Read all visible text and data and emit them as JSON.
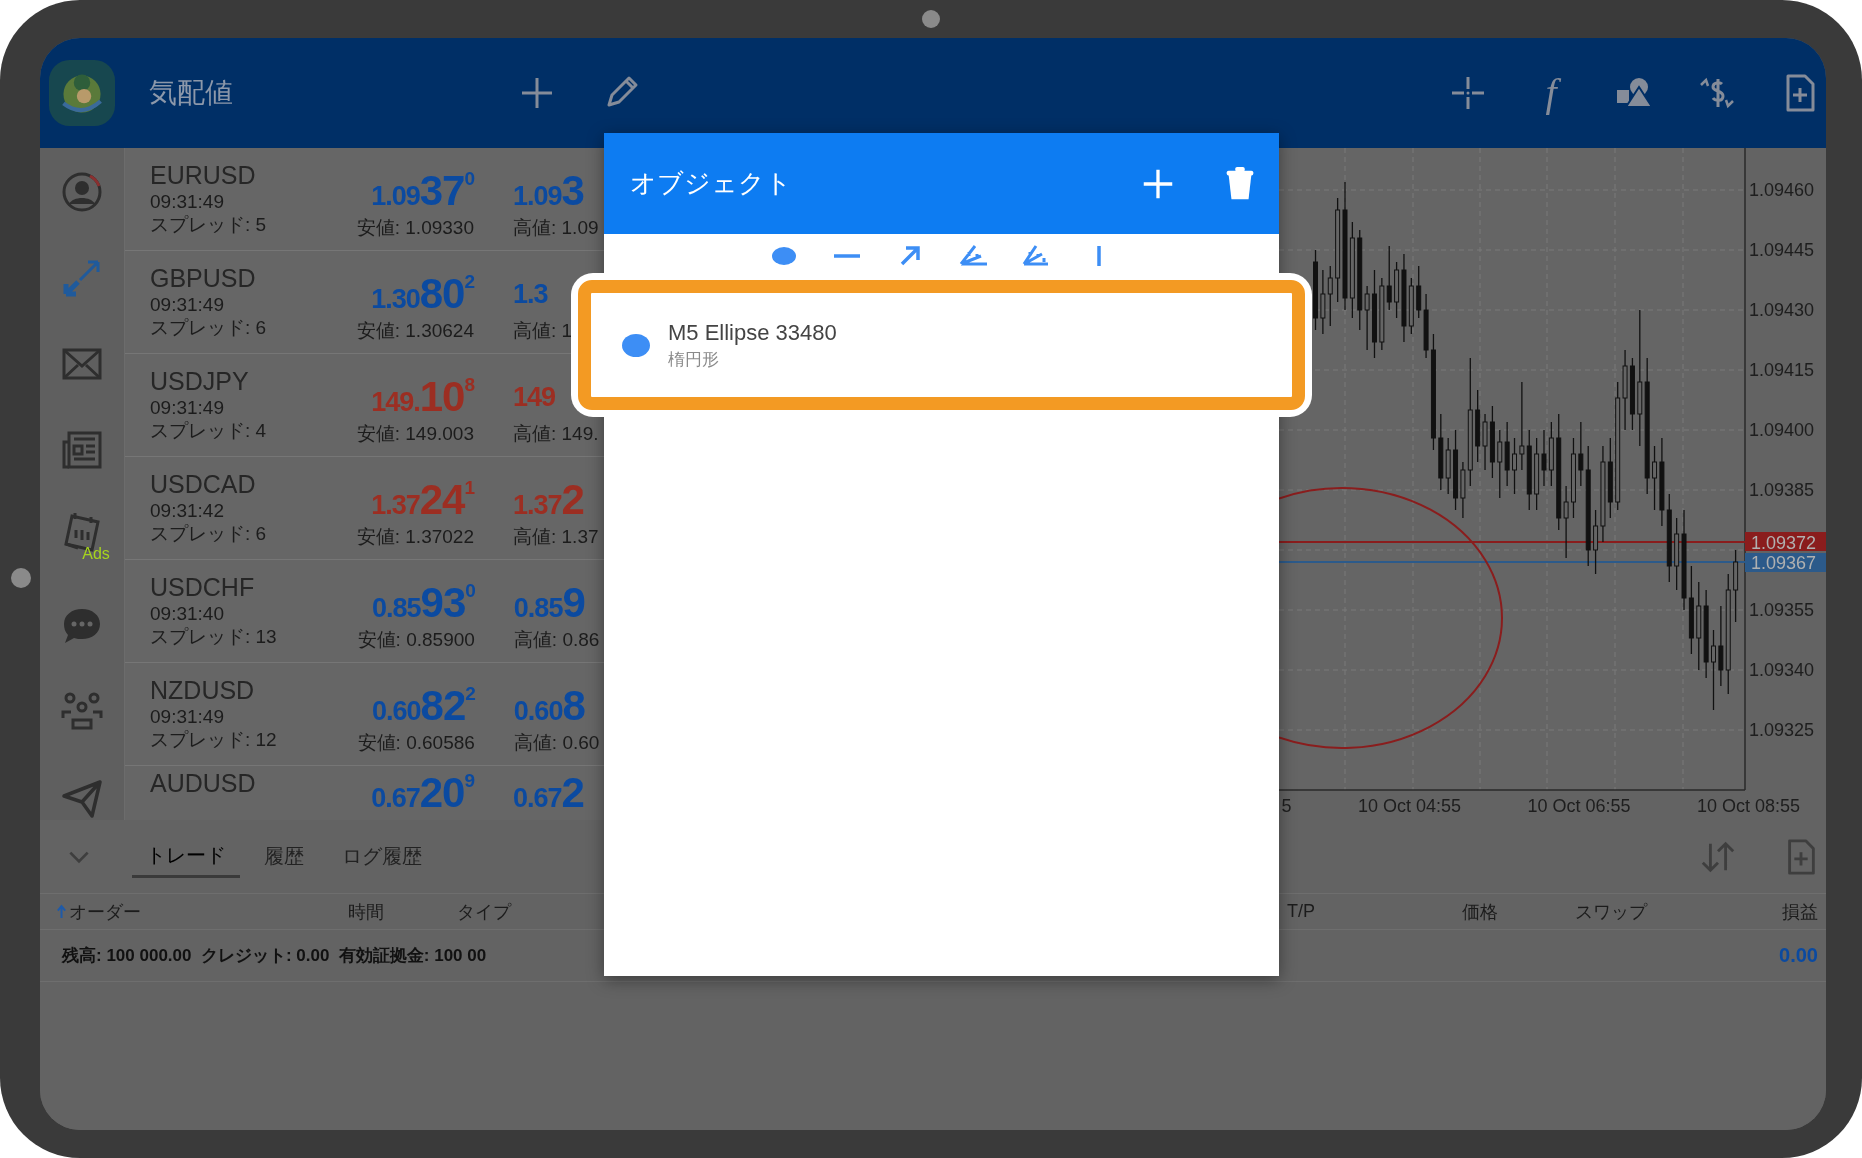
{
  "top_bar": {
    "title": "気配値",
    "function_glyph": "f"
  },
  "rail": {
    "ads_label": "Ads"
  },
  "quotes": [
    {
      "symbol": "EURUSD",
      "time": "09:31:49",
      "spread": "スプレッド: 5",
      "color": "#0b4aa0",
      "bid": {
        "prefix": "1.09",
        "big": "37",
        "sup": "0"
      },
      "low": "安値: 1.09330",
      "ask": {
        "prefix": "1.09",
        "big": "3"
      },
      "high": "高値: 1.09"
    },
    {
      "symbol": "GBPUSD",
      "time": "09:31:49",
      "spread": "スプレッド: 6",
      "color": "#0b4aa0",
      "bid": {
        "prefix": "1.30",
        "big": "80",
        "sup": "2"
      },
      "low": "安値: 1.30624",
      "ask": {
        "prefix": "1.3"
      },
      "high": "高値: 1"
    },
    {
      "symbol": "USDJPY",
      "time": "09:31:49",
      "spread": "スプレッド: 4",
      "color": "#9c2e22",
      "bid": {
        "prefix": "149.",
        "big": "10",
        "sup": "8"
      },
      "low": "安値: 149.003",
      "ask": {
        "prefix": "149"
      },
      "high": "高値: 149."
    },
    {
      "symbol": "USDCAD",
      "time": "09:31:42",
      "spread": "スプレッド: 6",
      "color": "#9c2e22",
      "bid": {
        "prefix": "1.37",
        "big": "24",
        "sup": "1"
      },
      "low": "安値: 1.37022",
      "ask": {
        "prefix": "1.37",
        "big": "2"
      },
      "high": "高値: 1.37"
    },
    {
      "symbol": "USDCHF",
      "time": "09:31:40",
      "spread": "スプレッド: 13",
      "color": "#0b4aa0",
      "bid": {
        "prefix": "0.85",
        "big": "93",
        "sup": "0"
      },
      "low": "安値: 0.85900",
      "ask": {
        "prefix": "0.85",
        "big": "9"
      },
      "high": "高値: 0.86"
    },
    {
      "symbol": "NZDUSD",
      "time": "09:31:49",
      "spread": "スプレッド: 12",
      "color": "#0b4aa0",
      "bid": {
        "prefix": "0.60",
        "big": "82",
        "sup": "2"
      },
      "low": "安値: 0.60586",
      "ask": {
        "prefix": "0.60",
        "big": "8"
      },
      "high": "高値: 0.60"
    },
    {
      "symbol": "AUDUSD",
      "color": "#0b4aa0",
      "bid": {
        "prefix": "0.67",
        "big": "20",
        "sup": "9"
      },
      "ask": {
        "prefix": "0.67",
        "big": "2"
      }
    }
  ],
  "chart": {
    "time_labels": [
      "5",
      "10 Oct 04:55",
      "10 Oct 06:55",
      "10 Oct 08:55"
    ],
    "chart_data": {
      "type": "candlestick",
      "grid": true,
      "ylim": [
        1.0931,
        1.094705
      ],
      "ohlc": [
        [
          1.09442,
          1.09445,
          1.09425,
          1.09428
        ],
        [
          1.09428,
          1.0944,
          1.09424,
          1.09434
        ],
        [
          1.09434,
          1.09441,
          1.09426,
          1.09438
        ],
        [
          1.09438,
          1.09458,
          1.09432,
          1.09455
        ],
        [
          1.09455,
          1.09462,
          1.0943,
          1.09433
        ],
        [
          1.09433,
          1.09452,
          1.09428,
          1.09448
        ],
        [
          1.09448,
          1.0945,
          1.09425,
          1.0943
        ],
        [
          1.0943,
          1.09436,
          1.0942,
          1.09434
        ],
        [
          1.09434,
          1.0944,
          1.09418,
          1.09422
        ],
        [
          1.09422,
          1.09438,
          1.0942,
          1.09436
        ],
        [
          1.09436,
          1.09446,
          1.0943,
          1.09432
        ],
        [
          1.09432,
          1.09442,
          1.09428,
          1.0944
        ],
        [
          1.0944,
          1.09444,
          1.09422,
          1.09426
        ],
        [
          1.09426,
          1.09438,
          1.09424,
          1.09436
        ],
        [
          1.09436,
          1.09441,
          1.09428,
          1.0943
        ],
        [
          1.0943,
          1.09434,
          1.09418,
          1.0942
        ],
        [
          1.0942,
          1.09424,
          1.09395,
          1.09398
        ],
        [
          1.09398,
          1.09404,
          1.09385,
          1.09388
        ],
        [
          1.09388,
          1.09398,
          1.09384,
          1.09395
        ],
        [
          1.09395,
          1.094,
          1.0938,
          1.09383
        ],
        [
          1.09383,
          1.09392,
          1.09378,
          1.0939
        ],
        [
          1.0939,
          1.09418,
          1.09386,
          1.09405
        ],
        [
          1.09405,
          1.0941,
          1.09392,
          1.09396
        ],
        [
          1.09396,
          1.09404,
          1.0939,
          1.09402
        ],
        [
          1.09402,
          1.09406,
          1.09388,
          1.09392
        ],
        [
          1.09392,
          1.094,
          1.09383,
          1.09397
        ],
        [
          1.09397,
          1.09402,
          1.09386,
          1.0939
        ],
        [
          1.0939,
          1.09398,
          1.09384,
          1.09394
        ],
        [
          1.09394,
          1.09412,
          1.0939,
          1.09396
        ],
        [
          1.09396,
          1.094,
          1.0938,
          1.09384
        ],
        [
          1.09384,
          1.09398,
          1.0938,
          1.09394
        ],
        [
          1.09394,
          1.094,
          1.09386,
          1.0939
        ],
        [
          1.0939,
          1.09402,
          1.09386,
          1.09398
        ],
        [
          1.09398,
          1.09404,
          1.09375,
          1.09378
        ],
        [
          1.09378,
          1.09386,
          1.09368,
          1.09382
        ],
        [
          1.09382,
          1.09398,
          1.09378,
          1.09394
        ],
        [
          1.09394,
          1.09402,
          1.09386,
          1.0939
        ],
        [
          1.0939,
          1.09396,
          1.09366,
          1.0937
        ],
        [
          1.0937,
          1.0938,
          1.09364,
          1.09376
        ],
        [
          1.09376,
          1.09396,
          1.09372,
          1.09392
        ],
        [
          1.09392,
          1.09398,
          1.09378,
          1.09382
        ],
        [
          1.09382,
          1.09412,
          1.0938,
          1.09408
        ],
        [
          1.09408,
          1.0942,
          1.094,
          1.09416
        ],
        [
          1.09416,
          1.09418,
          1.094,
          1.09404
        ],
        [
          1.09404,
          1.0943,
          1.09396,
          1.09412
        ],
        [
          1.09412,
          1.09418,
          1.09384,
          1.09388
        ],
        [
          1.09388,
          1.09396,
          1.0938,
          1.09392
        ],
        [
          1.09392,
          1.09398,
          1.09376,
          1.0938
        ],
        [
          1.0938,
          1.09384,
          1.09362,
          1.09366
        ],
        [
          1.09366,
          1.09378,
          1.0936,
          1.09374
        ],
        [
          1.09374,
          1.0938,
          1.09355,
          1.09358
        ],
        [
          1.09358,
          1.09366,
          1.09344,
          1.09348
        ],
        [
          1.09348,
          1.09362,
          1.0934,
          1.09356
        ],
        [
          1.09356,
          1.0936,
          1.09338,
          1.09342
        ],
        [
          1.09342,
          1.0935,
          1.0933,
          1.09346
        ],
        [
          1.09346,
          1.09356,
          1.09336,
          1.0934
        ],
        [
          1.0934,
          1.09364,
          1.09334,
          1.0936
        ],
        [
          1.0936,
          1.0937,
          1.09352,
          1.09367
        ]
      ],
      "yticks": [
        {
          "value": 1.0946,
          "label": "1.09460"
        },
        {
          "value": 1.09445,
          "label": "1.09445"
        },
        {
          "value": 1.0943,
          "label": "1.09430"
        },
        {
          "value": 1.09415,
          "label": "1.09415"
        },
        {
          "value": 1.094,
          "label": "1.09400"
        },
        {
          "value": 1.09385,
          "label": "1.09385"
        },
        {
          "value": 1.09355,
          "label": "1.09355"
        },
        {
          "value": 1.0934,
          "label": "1.09340"
        },
        {
          "value": 1.09325,
          "label": "1.09325"
        }
      ],
      "ref_lines": [
        {
          "axis": "y",
          "value": 1.09372,
          "label": "1.09372",
          "color": "#8a1d1d"
        },
        {
          "axis": "y",
          "value": 1.09367,
          "label": "1.09367",
          "color": "#2c5a8a"
        }
      ]
    }
  },
  "bottom_panel": {
    "tabs": [
      {
        "label": "トレード",
        "selected": true
      },
      {
        "label": "履歴",
        "selected": false
      },
      {
        "label": "ログ履歴",
        "selected": false
      }
    ],
    "left_columns": [
      {
        "label": "オーダー",
        "sorted": true
      },
      {
        "label": "時間",
        "sorted": false
      },
      {
        "label": "タイプ",
        "sorted": false
      }
    ],
    "right_columns": [
      {
        "label": "T/P",
        "sorted": false
      },
      {
        "label": "価格",
        "sorted": false
      },
      {
        "label": "スワップ",
        "sorted": false
      },
      {
        "label": "損益",
        "sorted": false
      }
    ],
    "balance": "残高: 100 000.00  クレジット: 0.00  有効証拠金: 100 00",
    "profit": "0.00"
  },
  "dialog": {
    "title": "オブジェクト",
    "objects": [
      {
        "name": "M5 Ellipse 33480",
        "type": "楕円形",
        "color": "#3d8ef5"
      }
    ]
  }
}
